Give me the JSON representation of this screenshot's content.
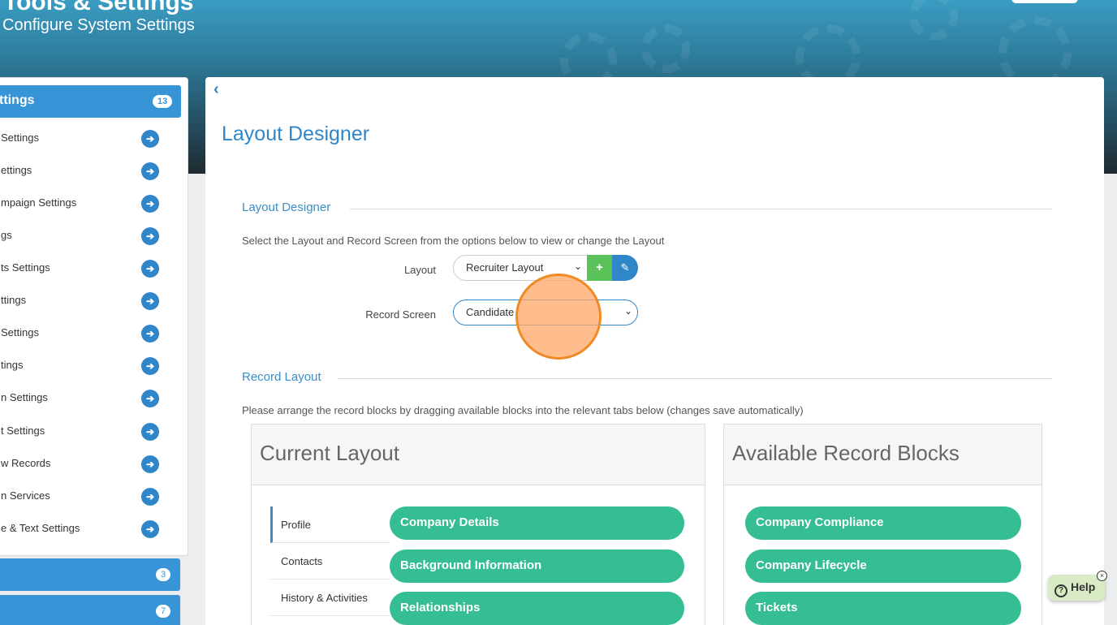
{
  "header": {
    "title": "Tools & Settings",
    "subtitle": "Configure System Settings"
  },
  "sidebar": {
    "group_title": "ttings",
    "group_count": "13",
    "items": [
      {
        "label": "Settings"
      },
      {
        "label": "ettings"
      },
      {
        "label": "mpaign Settings"
      },
      {
        "label": "gs"
      },
      {
        "label": "ts Settings"
      },
      {
        "label": "ttings"
      },
      {
        "label": " Settings"
      },
      {
        "label": "tings"
      },
      {
        "label": "n Settings"
      },
      {
        "label": "t Settings"
      },
      {
        "label": "w Records"
      },
      {
        "label": "n Services"
      },
      {
        "label": "e & Text Settings"
      }
    ],
    "group2_count": "3",
    "group3_count": "7"
  },
  "main": {
    "back_icon": "chevron-left-icon",
    "page_title": "Layout Designer",
    "section1_title": "Layout Designer",
    "section1_desc": "Select the Layout and Record Screen from the options below to view or change the Layout",
    "layout_label": "Layout",
    "layout_value": "Recruiter Layout",
    "add_label": "+",
    "edit_icon": "pencil-icon",
    "record_screen_label": "Record Screen",
    "record_screen_value": "Candidate",
    "section2_title": "Record Layout",
    "section2_desc": "Please arrange the record blocks by dragging available blocks into the relevant tabs below (changes save automatically)",
    "current_layout": {
      "title": "Current Layout",
      "tabs": [
        {
          "label": "Profile"
        },
        {
          "label": "Contacts"
        },
        {
          "label": "History & Activities"
        }
      ],
      "blocks": [
        {
          "label": "Company Details"
        },
        {
          "label": "Background Information"
        },
        {
          "label": "Relationships"
        }
      ]
    },
    "available_blocks": {
      "title": "Available Record Blocks",
      "blocks": [
        {
          "label": "Company Compliance"
        },
        {
          "label": "Company Lifecycle"
        },
        {
          "label": "Tickets"
        }
      ]
    }
  },
  "help": {
    "label": "Help",
    "close": "×"
  },
  "colors": {
    "accent": "#2f86c9",
    "block_green": "#35bd93",
    "add_green": "#5bc25a"
  }
}
